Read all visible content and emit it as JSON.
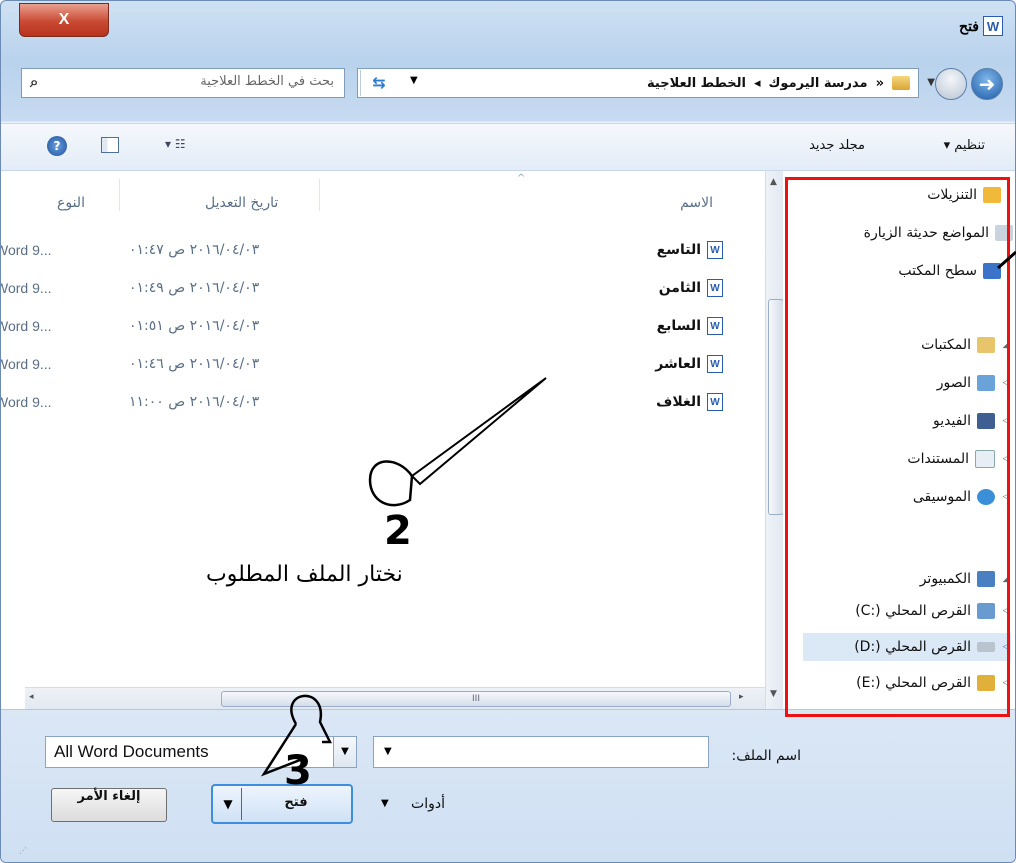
{
  "window": {
    "title": "فتح",
    "app_icon_letter": "W",
    "close_label": "X"
  },
  "address": {
    "chevrons": "«",
    "path": [
      "مدرسة اليرموك",
      "الخطط العلاجية"
    ],
    "separator": "◂",
    "refresh_icon": "refresh-icon"
  },
  "search": {
    "placeholder": "بحث في الخطط العلاجية",
    "icon": "search-icon"
  },
  "toolbar": {
    "organize_label": "تنظيم ▾",
    "new_folder_label": "مجلد جديد",
    "view_glyph": "▾ ☷",
    "help_glyph": "?"
  },
  "navpane": {
    "favorites": [
      {
        "label": "التنزيلات",
        "icon": "downloads-icon",
        "color": "#f0b93a"
      },
      {
        "label": "المواضع حديثة الزيارة",
        "icon": "recent-places-icon",
        "color": "#c9d4de"
      },
      {
        "label": "سطح المكتب",
        "icon": "desktop-icon",
        "color": "#3b73c9"
      }
    ],
    "libraries": {
      "label": "المكتبات",
      "icon": "libraries-icon",
      "items": [
        {
          "label": "الصور",
          "icon": "pictures-icon",
          "color": "#6aa3d9"
        },
        {
          "label": "الفيديو",
          "icon": "videos-icon",
          "color": "#3e5f8f"
        },
        {
          "label": "المستندات",
          "icon": "documents-icon",
          "color": "#e8eef5"
        },
        {
          "label": "الموسيقى",
          "icon": "music-icon",
          "color": "#3b8fd9"
        }
      ]
    },
    "computer": {
      "label": "الكمبيوتر",
      "icon": "computer-icon",
      "items": [
        {
          "label": "القرص المحلي (:C)",
          "icon": "drive-c-icon",
          "color": "#6a9bd0"
        },
        {
          "label": "القرص المحلي (:D)",
          "icon": "drive-d-icon",
          "color": "#b9c4cf",
          "selected": true
        },
        {
          "label": "القرص المحلي (:E)",
          "icon": "drive-e-icon",
          "color": "#e0b03a"
        }
      ]
    }
  },
  "filelist": {
    "columns": {
      "name": "الاسم",
      "date": "تاريخ التعديل",
      "type": "النوع"
    },
    "rows": [
      {
        "name": "التاسع",
        "date": "٢٠١٦/٠٤/٠٣ ص ٠١:٤٧",
        "type": "Word 9..."
      },
      {
        "name": "الثامن",
        "date": "٢٠١٦/٠٤/٠٣ ص ٠١:٤٩",
        "type": "Word 9..."
      },
      {
        "name": "السابع",
        "date": "٢٠١٦/٠٤/٠٣ ص ٠١:٥١",
        "type": "Word 9..."
      },
      {
        "name": "العاشر",
        "date": "٢٠١٦/٠٤/٠٣ ص ٠١:٤٦",
        "type": "Word 9..."
      },
      {
        "name": "الغلاف",
        "date": "٢٠١٦/٠٤/٠٣ ص ١١:٠٠",
        "type": "Word 9..."
      }
    ],
    "hscroll_grip": "III"
  },
  "annotations": {
    "step2_number": "2",
    "step2_text": "نختار الملف  المطلوب",
    "step3_number": "3"
  },
  "bottom": {
    "filename_label": "اسم الملف:",
    "filename_value": "",
    "filter_value": "All Word Documents",
    "tools_label": "أدوات",
    "open_label": "فتح",
    "cancel_label": "إلغاء الأمر"
  }
}
